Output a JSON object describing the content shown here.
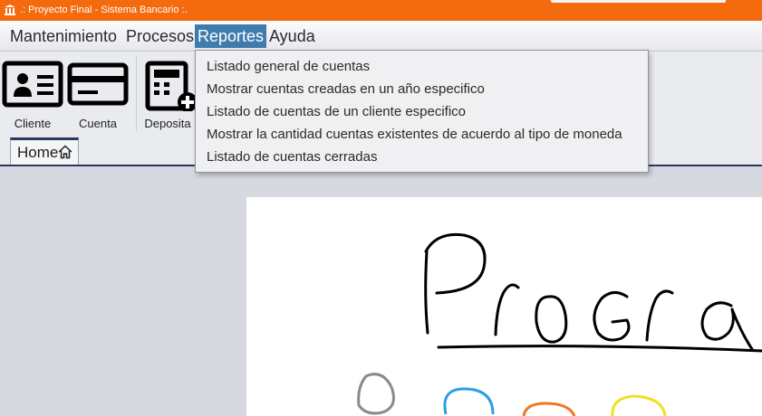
{
  "window": {
    "title": ".: Proyecto Final - Sistema Bancario :."
  },
  "menubar": {
    "items": [
      {
        "label": "Mantenimiento",
        "active": false
      },
      {
        "label": "Procesos",
        "active": false
      },
      {
        "label": "Reportes",
        "active": true
      },
      {
        "label": "Ayuda",
        "active": false
      }
    ]
  },
  "toolbar": {
    "tools": [
      {
        "label": "Cliente",
        "icon": "id-card-icon"
      },
      {
        "label": "Cuenta",
        "icon": "credit-card-icon"
      },
      {
        "label": "Deposita",
        "icon": "calculator-plus-icon"
      }
    ]
  },
  "tabs": [
    {
      "label": "Home",
      "icon": "home-icon",
      "active": true
    }
  ],
  "reportes_menu": {
    "items": [
      "Listado general de cuentas",
      "Mostrar cuentas creadas en un año especifico",
      "Listado de cuentas de un cliente especifico",
      "Mostrar la cantidad cuentas existentes de acuerdo al tipo de moneda",
      "Listado de cuentas cerradas"
    ]
  },
  "colors": {
    "titlebar": "#f46a0f",
    "menu_active": "#3f7cad",
    "tab_accent": "#2a3a5a",
    "sketch_blue": "#2aa0e0",
    "sketch_orange": "#f07820",
    "sketch_yellow": "#f0e020",
    "sketch_gray": "#8a8a8a"
  }
}
